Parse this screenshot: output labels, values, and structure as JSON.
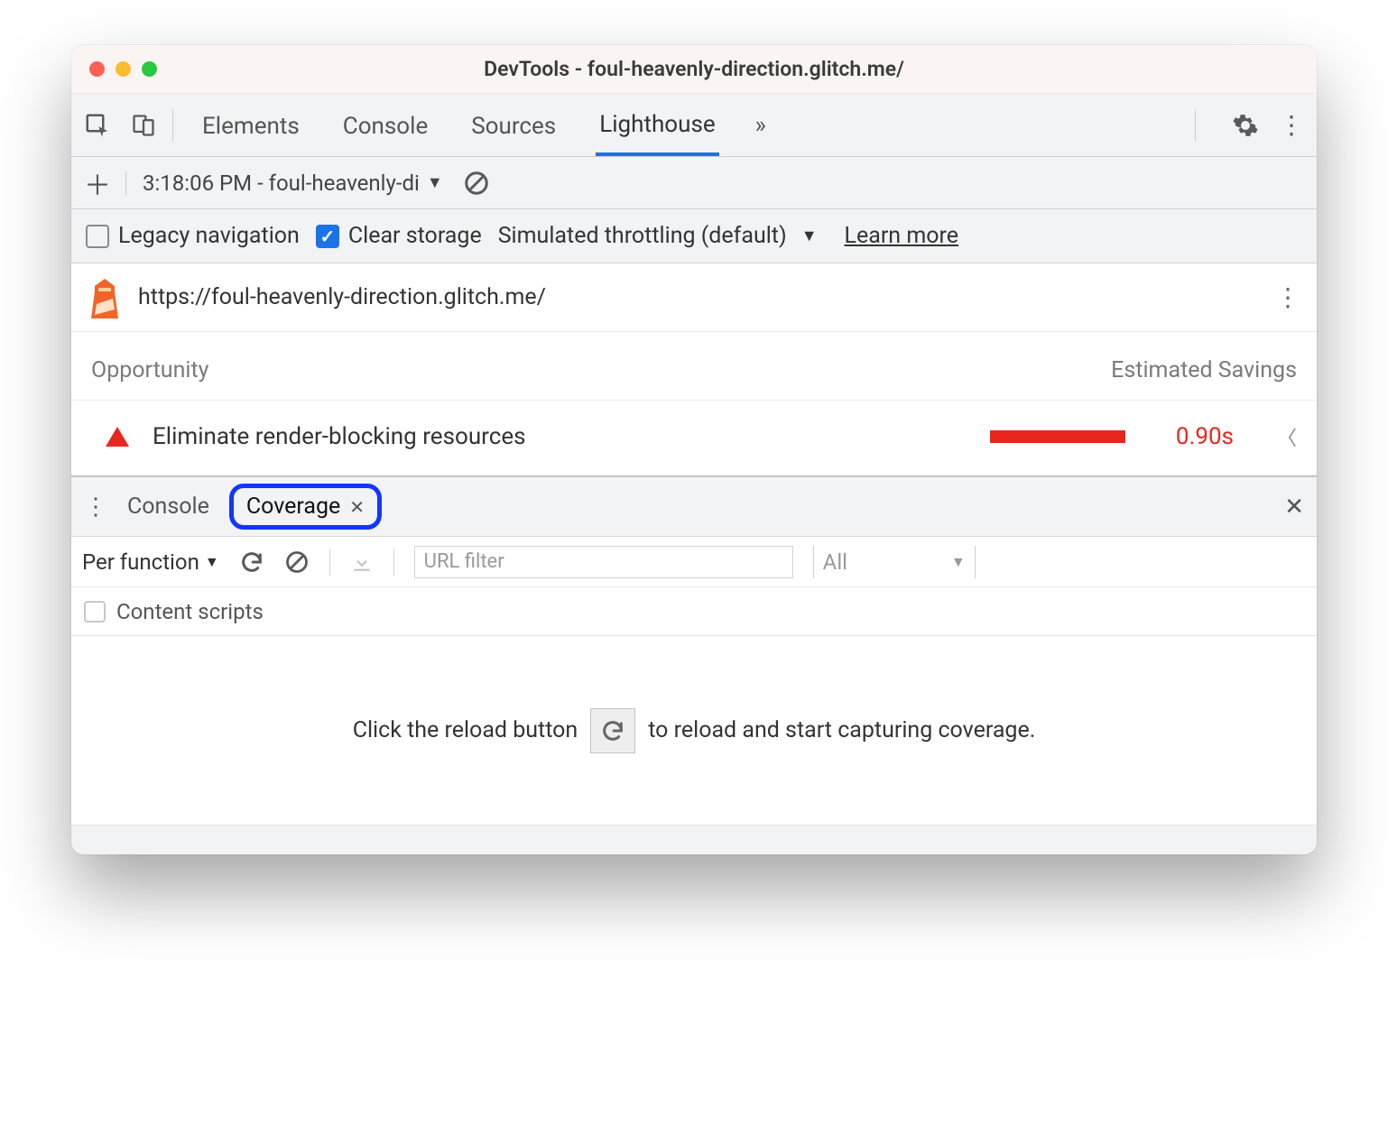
{
  "window": {
    "title": "DevTools - foul-heavenly-direction.glitch.me/"
  },
  "tabs": {
    "items": [
      "Elements",
      "Console",
      "Sources",
      "Lighthouse"
    ],
    "active": "Lighthouse"
  },
  "subtoolbar": {
    "report_label": "3:18:06 PM - foul-heavenly-di"
  },
  "options": {
    "legacy_label": "Legacy navigation",
    "legacy_checked": false,
    "clear_label": "Clear storage",
    "clear_checked": true,
    "throttle_label": "Simulated throttling (default)",
    "learn_more": "Learn more"
  },
  "report": {
    "url": "https://foul-heavenly-direction.glitch.me/"
  },
  "opportunity": {
    "header_left": "Opportunity",
    "header_right": "Estimated Savings",
    "item_label": "Eliminate render-blocking resources",
    "item_value": "0.90s"
  },
  "drawer": {
    "tab_console": "Console",
    "tab_coverage": "Coverage"
  },
  "coverage": {
    "granularity": "Per function",
    "url_filter_placeholder": "URL filter",
    "type_filter": "All",
    "content_scripts_label": "Content scripts",
    "hint_before": "Click the reload button",
    "hint_after": "to reload and start capturing coverage."
  }
}
